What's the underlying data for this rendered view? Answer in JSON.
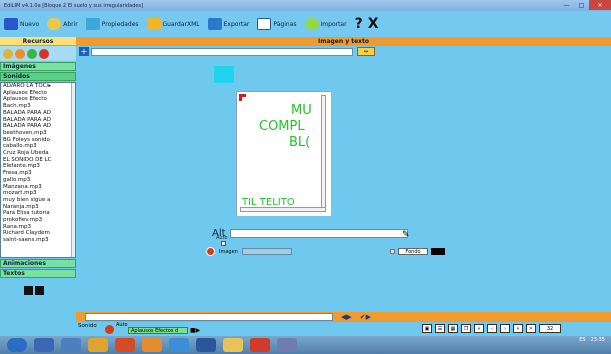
{
  "window": {
    "title": "EdiLIM v4.1.0a  [Bloque 2 El suelo y sus irregularidades]",
    "min_label": "—",
    "max_label": "□",
    "close_label": "✕"
  },
  "toolbar": {
    "nuevo": "Nuevo",
    "abrir": "Abrir",
    "propiedades": "Propiedades",
    "guardar": "GuardarXML",
    "exportar": "Exportar",
    "paginas": "Páginas",
    "importar": "Importar",
    "help": "?",
    "close_big": "X"
  },
  "left": {
    "header": "Recursos",
    "sections": [
      "Imágenes",
      "Sonidos",
      "Animaciones",
      "Textos"
    ],
    "sounds": [
      "ALVARO LA TOC/▸",
      "Aplausos  Efecto",
      "Aplausos  Efecto",
      "Bach.mp3",
      "BALADA PARA AD",
      "BALADA PARA AD",
      "BALADA PARA AD",
      "beethoven.mp3",
      "BG Foleys sonido",
      "caballo.mp3",
      "Cruz Roja Ubeda",
      "EL SONIDO DE LC",
      "Elefante.mp3",
      "Fresa.mp3",
      "gallo.mp3",
      "Manzana.mp3",
      "mozart.mp3",
      "muy bien sigue a",
      "Naranja.mp3",
      "Para Elisa  tutoria",
      "prokofiev.mp3",
      "Rana.mp3",
      "Richard  Claydem",
      "saint-saens.mp3"
    ]
  },
  "main": {
    "header": "Imagen y texto",
    "card_text": [
      "MU",
      "COMPL",
      "BL(",
      "TIL  TELITO"
    ],
    "alt_label": "Alt",
    "auto_label": "Auto",
    "imagen_label": "Imagen",
    "fondo_label": "Fondo"
  },
  "sound": {
    "label": "Sonido",
    "auto_label": "Auto",
    "field": "Aplausos  Efectos d"
  },
  "footer": {
    "zoom": "32"
  },
  "taskbar": {
    "lang": "ES",
    "time": "23:35"
  }
}
